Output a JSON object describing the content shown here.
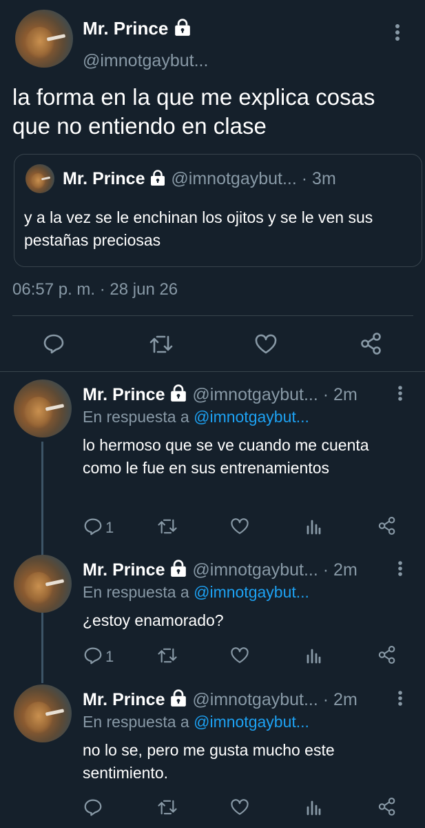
{
  "main_tweet": {
    "name": "Mr. Prince",
    "handle": "@imnotgaybut...",
    "text": "la forma en la que me explica cosas que no entiendo en clase",
    "timestamp": "06:57 p. m. · 28 jun 26",
    "quoted": {
      "name": "Mr. Prince",
      "handle": "@imnotgaybut...",
      "time": "· 3m",
      "text": "y a la vez se le enchinan los ojitos y se le ven sus pestañas preciosas"
    },
    "icons": [
      "reply-icon",
      "retweet-icon",
      "like-icon",
      "share-icon"
    ]
  },
  "replies": [
    {
      "name": "Mr. Prince",
      "handle": "@imnotgaybut...",
      "time": "· 2m",
      "reply_prefix": "En respuesta a",
      "reply_to": "@imnotgaybut...",
      "text": "lo hermoso que se ve cuando me cuenta como le fue en sus entrenamientos",
      "reply_count": "1"
    },
    {
      "name": "Mr. Prince",
      "handle": "@imnotgaybut...",
      "time": "· 2m",
      "reply_prefix": "En respuesta a",
      "reply_to": "@imnotgaybut...",
      "text": "¿estoy enamorado?",
      "reply_count": "1"
    },
    {
      "name": "Mr. Prince",
      "handle": "@imnotgaybut...",
      "time": "· 2m",
      "reply_prefix": "En respuesta a",
      "reply_to": "@imnotgaybut...",
      "text": "no lo se, pero me gusta mucho este sentimiento.",
      "reply_count": ""
    }
  ],
  "colors": {
    "background": "#15202b",
    "text": "#ffffff",
    "muted": "#8899a6",
    "link": "#1da1f2",
    "border": "#38444d"
  }
}
